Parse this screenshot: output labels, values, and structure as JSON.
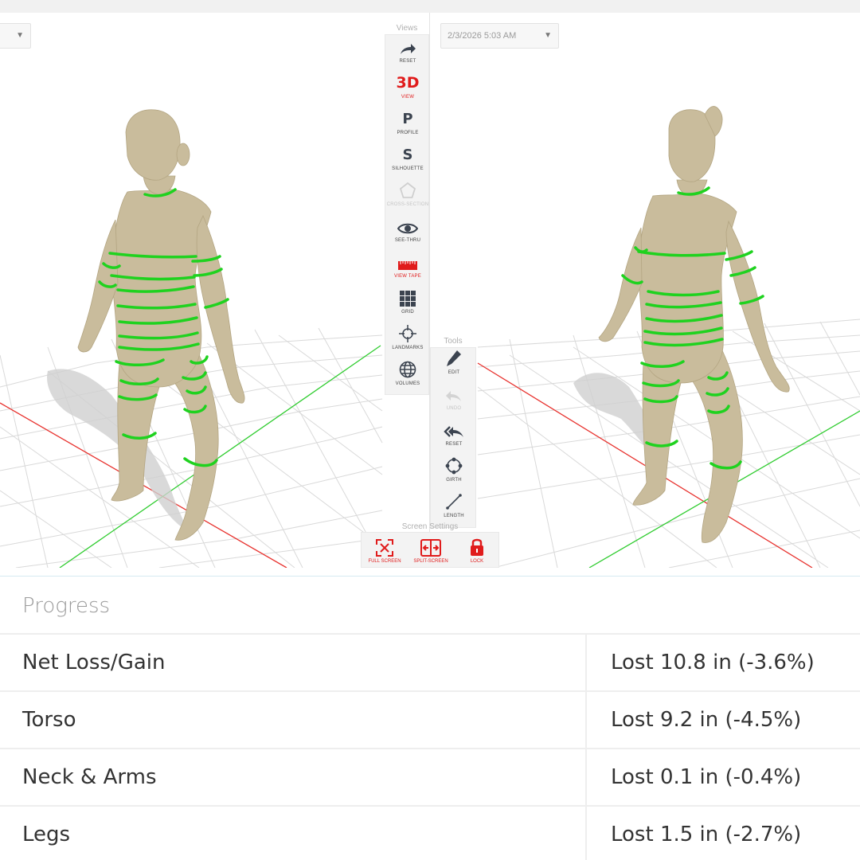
{
  "viewer": {
    "right_date": "2/3/2026 5:03 AM",
    "left_date": "",
    "views_title": "Views",
    "tools_title": "Tools",
    "screen_title": "Screen Settings",
    "views": [
      {
        "key": "reset",
        "label": "RESET",
        "icon": "redo-arrow-icon"
      },
      {
        "key": "3d",
        "label": "VIEW",
        "icon_text": "3D",
        "active": true
      },
      {
        "key": "profile",
        "label": "PROFILE",
        "icon_text": "P"
      },
      {
        "key": "silhouette",
        "label": "SILHOUETTE",
        "icon_text": "S"
      },
      {
        "key": "cross-section",
        "label": "CROSS-SECTION",
        "icon": "pentagon-icon",
        "disabled": true
      },
      {
        "key": "see-thru",
        "label": "SEE-THRU",
        "icon": "eye-icon"
      },
      {
        "key": "view-tape",
        "label": "VIEW TAPE",
        "icon": "tape-measure-icon",
        "active": true
      },
      {
        "key": "grid",
        "label": "GRID",
        "icon": "grid-icon"
      },
      {
        "key": "landmarks",
        "label": "LANDMARKS",
        "icon": "crosshair-icon"
      },
      {
        "key": "volumes",
        "label": "VOLUMES",
        "icon": "globe-icon"
      }
    ],
    "tools": [
      {
        "key": "edit",
        "label": "EDIT",
        "icon": "pen-icon"
      },
      {
        "key": "undo",
        "label": "UNDO",
        "icon": "undo-icon",
        "disabled": true
      },
      {
        "key": "reset",
        "label": "RESET",
        "icon": "double-back-arrow-icon"
      },
      {
        "key": "girth",
        "label": "GIRTH",
        "icon": "girth-circle-icon"
      },
      {
        "key": "length",
        "label": "LENGTH",
        "icon": "length-line-icon"
      }
    ],
    "screen_settings": [
      {
        "key": "full-screen",
        "label": "FULL SCREEN",
        "icon": "full-screen-icon"
      },
      {
        "key": "split-screen",
        "label": "SPLIT-SCREEN",
        "icon": "split-screen-icon"
      },
      {
        "key": "lock",
        "label": "LOCK",
        "icon": "lock-icon"
      }
    ],
    "colors": {
      "accent": "#e01b1b",
      "icon": "#3c4450",
      "body": "#c9bc9c",
      "tape": "#1fd21f",
      "axis_x": "#e8322e",
      "axis_z": "#2fcc2f",
      "grid": "#d8d8d8"
    }
  },
  "progress": {
    "title": "Progress",
    "rows": [
      {
        "name": "Net Loss/Gain",
        "value": "Lost 10.8 in (-3.6%)"
      },
      {
        "name": "Torso",
        "value": "Lost 9.2 in (-4.5%)"
      },
      {
        "name": "Neck & Arms",
        "value": "Lost 0.1 in (-0.4%)"
      },
      {
        "name": "Legs",
        "value": "Lost 1.5 in (-2.7%)"
      }
    ]
  }
}
